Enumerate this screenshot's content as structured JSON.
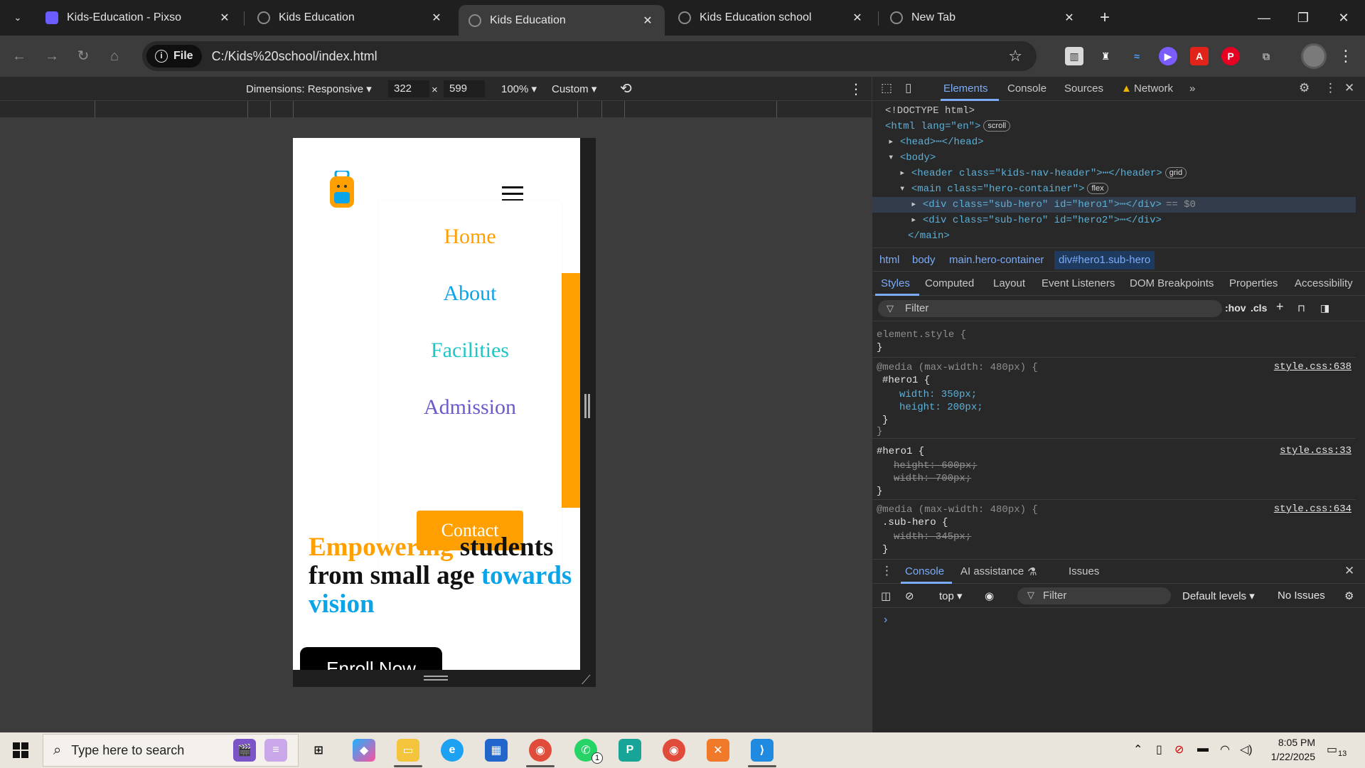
{
  "browser": {
    "tabs": [
      {
        "title": "Kids-Education - Pixso",
        "favicon_color": "#6b5cff"
      },
      {
        "title": "Kids Education",
        "favicon_color": "#8a8a8a"
      },
      {
        "title": "Kids Education",
        "favicon_color": "#8a8a8a"
      },
      {
        "title": "Kids Education school",
        "favicon_color": "#8a8a8a"
      },
      {
        "title": "New Tab",
        "favicon_color": "#8a8a8a"
      }
    ],
    "active_tab_index": 2,
    "close_glyph": "✕",
    "new_tab_glyph": "+",
    "chip_label": "File",
    "url": "C:/Kids%20school/index.html"
  },
  "device_toolbar": {
    "dimensions_label": "Dimensions: Responsive ▾",
    "width": "322",
    "times": "×",
    "height": "599",
    "zoom": "100% ▾",
    "throttle": "Custom ▾"
  },
  "site": {
    "nav": [
      "Home",
      "About",
      "Facilities",
      "Admission"
    ],
    "nav_colors": [
      "#ff9f00",
      "#0aa4e8",
      "#1ec6c6",
      "#6a5acd"
    ],
    "contact": "Contact",
    "headline": {
      "w1": "Empowering",
      "w2": " students from small age ",
      "w3": "towards vision"
    },
    "enroll": "Enroll Now",
    "accent_orange": "#ff9f00",
    "accent_blue": "#0aa4e8"
  },
  "devtools": {
    "tabs": [
      "Elements",
      "Console",
      "Sources",
      "Network"
    ],
    "more": "»",
    "dom": {
      "doctype": "<!DOCTYPE html>",
      "html_open": "<html lang=\"en\">",
      "scroll_badge": "scroll",
      "head": "<head>⋯</head>",
      "body_open": "<body>",
      "header": "<header class=\"kids-nav-header\">⋯</header>",
      "grid_badge": "grid",
      "main_open": "<main class=\"hero-container\">",
      "flex_badge": "flex",
      "hero1": "<div class=\"sub-hero\" id=\"hero1\">⋯</div>",
      "dollar": "== $0",
      "hero2": "<div class=\"sub-hero\" id=\"hero2\">⋯</div>",
      "main_close": "</main>"
    },
    "breadcrumbs": [
      "html",
      "body",
      "main.hero-container",
      "div#hero1.sub-hero"
    ],
    "subtabs": [
      "Styles",
      "Computed",
      "Layout",
      "Event Listeners",
      "DOM Breakpoints",
      "Properties",
      "Accessibility"
    ],
    "filter_placeholder": "Filter",
    "hov": ":hov",
    "cls": ".cls",
    "styles": {
      "element_style": "element.style {",
      "close": "}",
      "mq1": "@media (max-width: 480px) {",
      "sel1": "#hero1 {",
      "p1": "width: 350px;",
      "p2": "height: 200px;",
      "src1": "style.css:638",
      "sel2": "#hero1 {",
      "p3": "height: 600px;",
      "p4": "width: 700px;",
      "src2": "style.css:33",
      "mq2": "@media (max-width: 480px) {",
      "sel3": ".sub-hero {",
      "p5": "width: 345px;",
      "src3": "style.css:634"
    },
    "drawer_tabs": [
      "Console",
      "AI assistance",
      "Issues"
    ],
    "console_bar": {
      "context": "top ▾",
      "filter": "Filter",
      "levels": "Default levels ▾",
      "issues": "No Issues"
    },
    "prompt": "›"
  },
  "taskbar": {
    "search_placeholder": "Type here to search",
    "time": "8:05 PM",
    "date": "1/22/2025",
    "notifications": "13",
    "whatsapp_badge": "1"
  }
}
